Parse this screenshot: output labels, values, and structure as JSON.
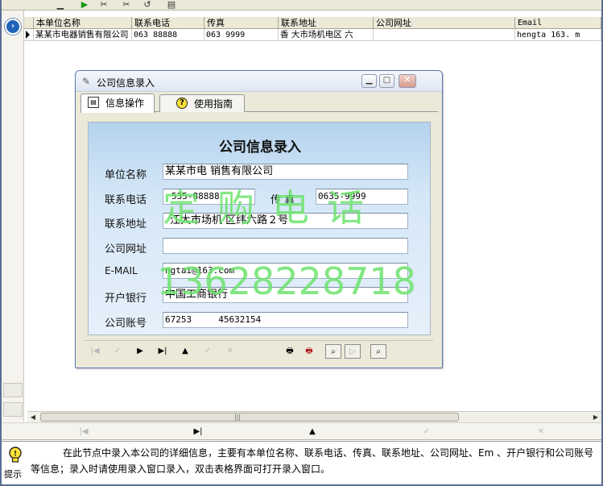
{
  "grid": {
    "columns": [
      "本单位名称",
      "联系电话",
      "传真",
      "联系地址",
      "公司网址",
      "Email"
    ],
    "row": [
      "某某市电器销售有限公司",
      "063 88888",
      "063 9999",
      "香 大市场机电区 六",
      "",
      "hengta 163. m"
    ]
  },
  "dialog": {
    "title": "公司信息录入",
    "tabs": [
      "信息操作",
      "使用指南"
    ],
    "form_title": "公司信息录入",
    "fields": {
      "company_name": {
        "label": "单位名称",
        "value": "某某市电 销售有限公司"
      },
      "phone": {
        "label": "联系电话",
        "value": "535-88888"
      },
      "fax": {
        "label": "传 真",
        "value": "0635-9999"
      },
      "address": {
        "label": "联系地址",
        "value": "江大市场机 区纬六路２号"
      },
      "website": {
        "label": "公司网址",
        "value": ""
      },
      "email": {
        "label": "E-MAIL",
        "value": " ngtai@163.com"
      },
      "bank": {
        "label": "开户银行",
        "value": "中国工商银行"
      },
      "account": {
        "label": "公司账号",
        "value": "67253     45632154"
      }
    }
  },
  "watermark": {
    "line1": "定购电话",
    "line2": "13628228718"
  },
  "hint": {
    "label": "提示",
    "text": "在此节点中录入本公司的详细信息，主要有本单位名称、联系电话、传真、联系地址、公司网址、Em 、开户银行和公司账号等信息；录入时请使用录入窗口录入，双击表格界面可打开录入窗口。"
  },
  "colors": {
    "frame": "#5a6e94",
    "panel_top": "#b5d3ee",
    "watermark": "#6ee36e",
    "title_bar": "#dfe6f2"
  }
}
